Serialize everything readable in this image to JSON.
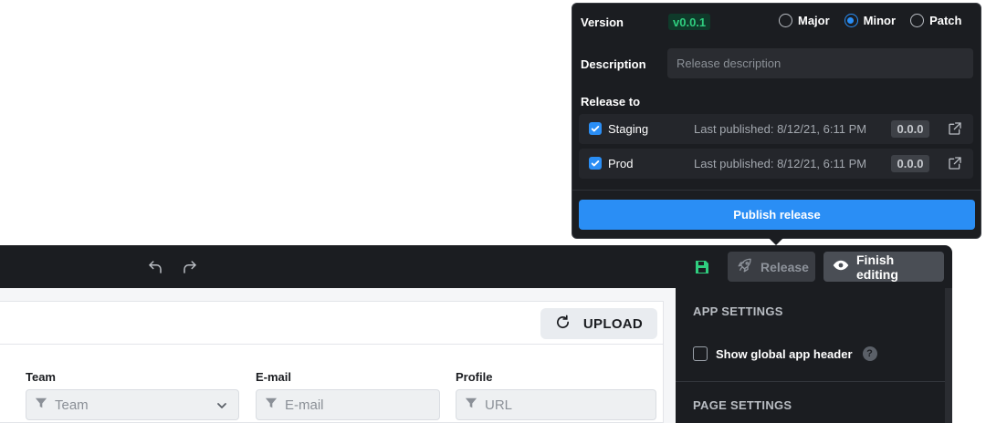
{
  "popover": {
    "version_label": "Version",
    "version_value": "v0.0.1",
    "bump_options": [
      {
        "label": "Major",
        "selected": false
      },
      {
        "label": "Minor",
        "selected": true
      },
      {
        "label": "Patch",
        "selected": false
      }
    ],
    "description_label": "Description",
    "description_placeholder": "Release description",
    "description_value": "",
    "release_to_label": "Release to",
    "targets": [
      {
        "name": "Staging",
        "checked": true,
        "last_published": "Last published: 8/12/21, 6:11 PM",
        "version": "0.0.0"
      },
      {
        "name": "Prod",
        "checked": true,
        "last_published": "Last published: 8/12/21, 6:11 PM",
        "version": "0.0.0"
      }
    ],
    "publish_label": "Publish release"
  },
  "toolbar": {
    "release_label": "Release",
    "finish_label": "Finish editing"
  },
  "canvas": {
    "upload_label": "UPLOAD",
    "fields": [
      {
        "label": "Team",
        "placeholder": "Team",
        "has_dropdown": true
      },
      {
        "label": "E-mail",
        "placeholder": "E-mail",
        "has_dropdown": false
      },
      {
        "label": "Profile",
        "placeholder": "URL",
        "has_dropdown": false
      }
    ]
  },
  "settings": {
    "app_settings_heading": "APP SETTINGS",
    "show_header_label": "Show global app header",
    "show_header_checked": false,
    "help_glyph": "?",
    "page_settings_heading": "PAGE SETTINGS"
  },
  "colors": {
    "accent": "#2a8ef5",
    "panel_bg": "#1b1d21",
    "version_green": "#2fce7f",
    "save_icon_green": "#2fce7f"
  },
  "icons": [
    "undo-icon",
    "redo-icon",
    "save-icon",
    "rocket-icon",
    "eye-icon",
    "refresh-icon",
    "filter-icon",
    "chevron-down-icon",
    "external-link-icon",
    "check-icon"
  ]
}
